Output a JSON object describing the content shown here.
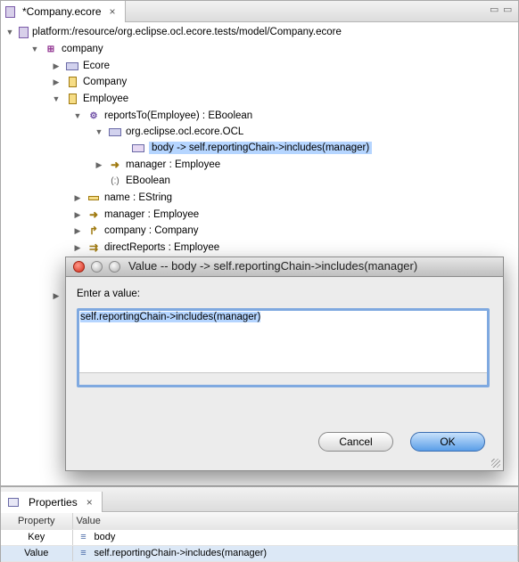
{
  "editor": {
    "tab_title": "*Company.ecore",
    "close_glyph": "×"
  },
  "tree": {
    "resource": "platform:/resource/org.eclipse.ocl.ecore.tests/model/Company.ecore",
    "package": "company",
    "ecore_ann": "Ecore",
    "company_cls": "Company",
    "employee_cls": "Employee",
    "reports_op": "reportsTo(Employee) : EBoolean",
    "ocl_ann": "org.eclipse.ocl.ecore.OCL",
    "body_entry": "body -> self.reportingChain->includes(manager)",
    "manager_param": "manager : Employee",
    "eboolean": "EBoolean",
    "name_attr": "name : EString",
    "manager_ref": "manager : Employee",
    "company_ref": "company : Company",
    "direct_reports": "directReports : Employee"
  },
  "dialog": {
    "title": "Value -- body -> self.reportingChain->includes(manager)",
    "prompt": "Enter a value:",
    "value": "self.reportingChain->includes(manager)",
    "cancel_label": "Cancel",
    "ok_label": "OK"
  },
  "properties": {
    "tab_title": "Properties",
    "col_property": "Property",
    "col_value": "Value",
    "rows": [
      {
        "key": "Key",
        "value": "body"
      },
      {
        "key": "Value",
        "value": "self.reportingChain->includes(manager)"
      }
    ]
  },
  "colors": {
    "selection": "#b5d5ff",
    "focus_ring": "#7fa9e0",
    "ok_button": "#5a9ee8"
  }
}
